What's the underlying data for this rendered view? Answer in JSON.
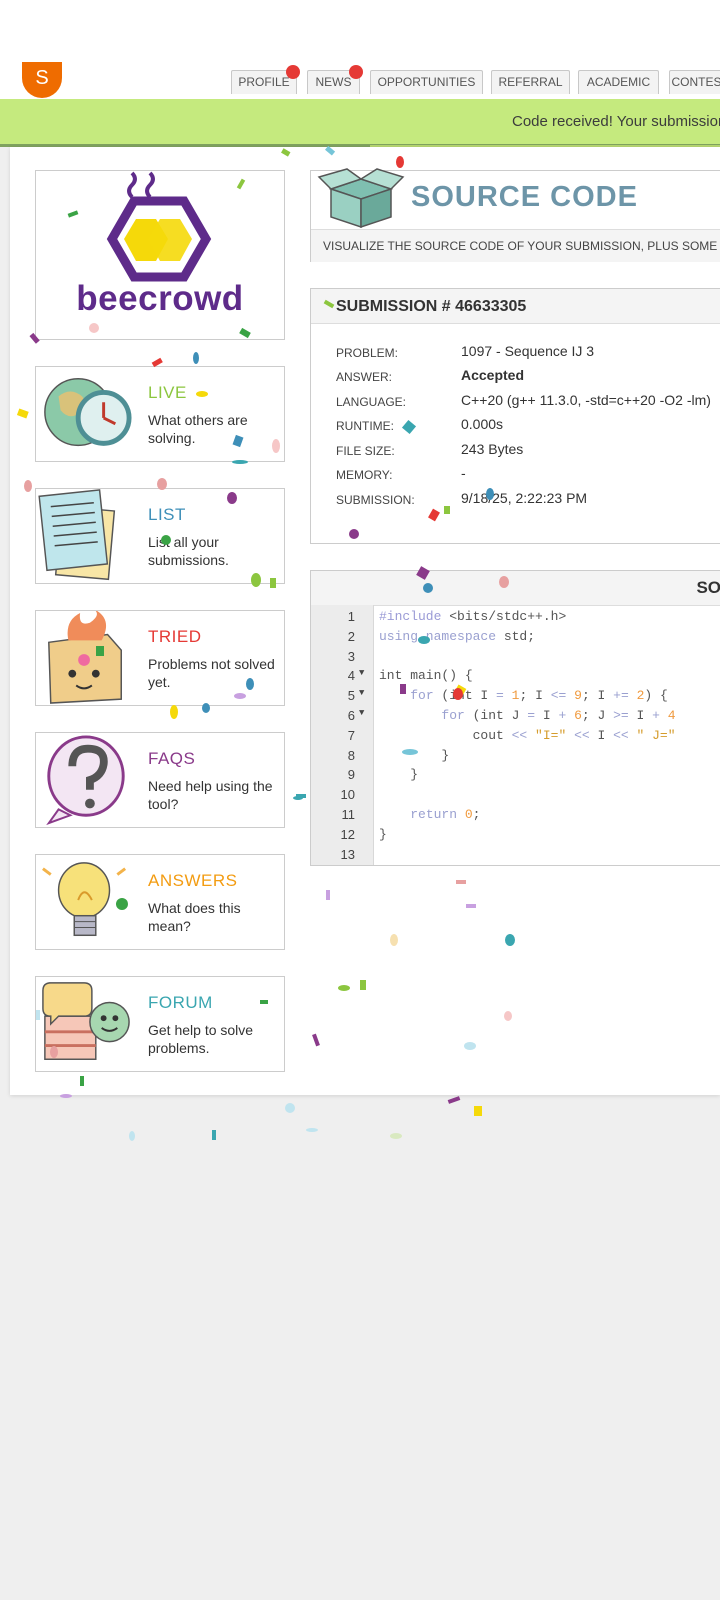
{
  "header": {
    "avatar_initial": "S",
    "nav": [
      {
        "label": "PROFILE",
        "badge": true
      },
      {
        "label": "NEWS",
        "badge": true
      },
      {
        "label": "OPPORTUNITIES",
        "badge": false
      },
      {
        "label": "REFERRAL",
        "badge": false
      },
      {
        "label": "ACADEMIC",
        "badge": false
      },
      {
        "label": "CONTES",
        "badge": false
      }
    ]
  },
  "notice": {
    "text": "Code received! Your submission"
  },
  "brand": {
    "logo_text": "beecrowd",
    "logo_color": "#5e2b8a",
    "logo_accent": "#f5d90a"
  },
  "sidebar": {
    "cards": [
      {
        "title": "LIVE",
        "desc": "What others are solving.",
        "color": "#8cc63f",
        "icon": "globe-clock-icon"
      },
      {
        "title": "LIST",
        "desc": "List all your submissions.",
        "color": "#3e8fb8",
        "icon": "document-list-icon"
      },
      {
        "title": "TRIED",
        "desc": "Problems not solved yet.",
        "color": "#e53935",
        "icon": "burning-box-icon"
      },
      {
        "title": "FAQS",
        "desc": "Need help using the tool?",
        "color": "#8a3a8a",
        "icon": "question-bubble-icon"
      },
      {
        "title": "ANSWERS",
        "desc": "What does this mean?",
        "color": "#f39c12",
        "icon": "lightbulb-icon"
      },
      {
        "title": "FORUM",
        "desc": "Get help to solve problems.",
        "color": "#3aa6b0",
        "icon": "chat-bubbles-icon"
      }
    ]
  },
  "source": {
    "title": "SOURCE CODE",
    "subtitle": "VISUALIZE THE SOURCE CODE OF YOUR SUBMISSION, PLUS SOME EXT",
    "icon": "open-box-icon"
  },
  "submission": {
    "title": "SUBMISSION # 46633305",
    "rows": [
      {
        "key": "PROBLEM:",
        "value": "1097 - Sequence IJ 3"
      },
      {
        "key": "ANSWER:",
        "value": "Accepted"
      },
      {
        "key": "LANGUAGE:",
        "value": "C++20 (g++ 11.3.0, -std=c++20 -O2 -lm)"
      },
      {
        "key": "RUNTIME:",
        "value": "0.000s"
      },
      {
        "key": "FILE SIZE:",
        "value": "243 Bytes"
      },
      {
        "key": "MEMORY:",
        "value": "-"
      },
      {
        "key": "SUBMISSION:",
        "value": "9/18/25, 2:22:23 PM"
      }
    ]
  },
  "code": {
    "header_label": "SO",
    "lines": [
      {
        "n": "1",
        "fold": false,
        "html": "<span class=\"pp\">#include</span> &lt;bits/stdc++.h&gt;"
      },
      {
        "n": "2",
        "fold": false,
        "html": "<span class=\"kw\">using namespace</span> std;"
      },
      {
        "n": "3",
        "fold": false,
        "html": ""
      },
      {
        "n": "4",
        "fold": true,
        "html": "int main() {"
      },
      {
        "n": "5",
        "fold": true,
        "html": "    <span class=\"kw\">for</span> (int I <span class=\"kw\">=</span> <span class=\"num\">1</span>; I <span class=\"kw\">&lt;=</span> <span class=\"num\">9</span>; I <span class=\"kw\">+=</span> <span class=\"num\">2</span>) {"
      },
      {
        "n": "6",
        "fold": true,
        "html": "        <span class=\"kw\">for</span> (int J <span class=\"kw\">=</span> I <span class=\"kw\">+</span> <span class=\"num\">6</span>; J <span class=\"kw\">&gt;=</span> I <span class=\"kw\">+</span> <span class=\"num\">4</span>"
      },
      {
        "n": "7",
        "fold": false,
        "html": "            cout <span class=\"kw\">&lt;&lt;</span> <span class=\"str\">\"I=\"</span> <span class=\"kw\">&lt;&lt;</span> I <span class=\"kw\">&lt;&lt;</span> <span class=\"str\">\" J=\"</span>"
      },
      {
        "n": "8",
        "fold": false,
        "html": "        }"
      },
      {
        "n": "9",
        "fold": false,
        "html": "    }"
      },
      {
        "n": "10",
        "fold": false,
        "html": ""
      },
      {
        "n": "11",
        "fold": false,
        "html": "    <span class=\"kw\">return</span> <span class=\"num\">0</span>;"
      },
      {
        "n": "12",
        "fold": false,
        "html": "}"
      },
      {
        "n": "13",
        "fold": false,
        "html": ""
      }
    ]
  }
}
